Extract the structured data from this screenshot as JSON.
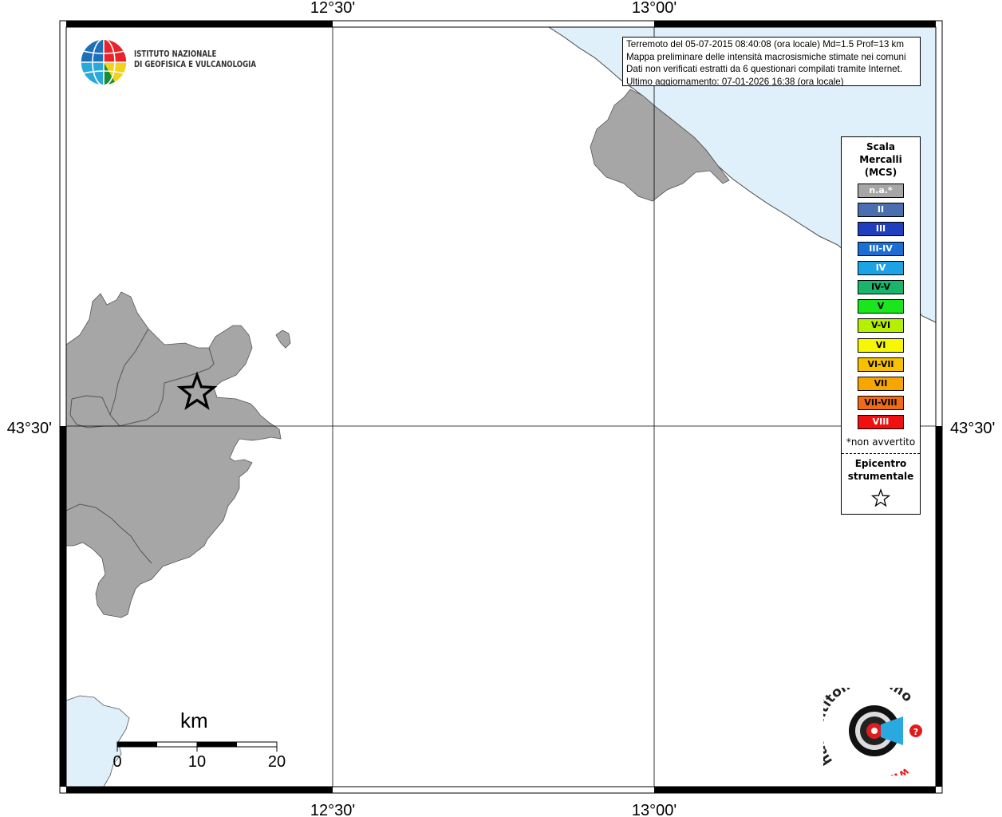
{
  "map": {
    "axes": {
      "top_labels": [
        "12°30'",
        "13°00'"
      ],
      "bottom_labels": [
        "12°30'",
        "13°00'"
      ],
      "left_label": "43°30'",
      "right_label": "43°30'"
    },
    "colors": {
      "land": "#a6a6a6",
      "sea": "#dff0fb",
      "frame": "#000000"
    }
  },
  "institute_logo": {
    "line1": "ISTITUTO NAZIONALE",
    "line2": "DI GEOFISICA E VULCANOLOGIA",
    "icon": "globe-icon"
  },
  "info_box": {
    "lines": [
      "Terremoto del 05-07-2015 08:40:08 (ora locale) Md=1.5 Prof=13 km",
      "Mappa preliminare delle intensità macrosismiche stimate nei comuni",
      "Dati non verificati estratti da 6 questionari compilati tramite Internet.",
      "Ultimo aggiornamento: 07-01-2026 16:38 (ora locale)"
    ]
  },
  "legend": {
    "title_lines": [
      "Scala",
      "Mercalli",
      "(MCS)"
    ],
    "items": [
      {
        "label": "n.a.*",
        "color": "#a6a6a6",
        "text_color": "#ffffff"
      },
      {
        "label": "II",
        "color": "#4a6fb0",
        "text_color": "#ffffff"
      },
      {
        "label": "III",
        "color": "#1f3fbf",
        "text_color": "#ffffff"
      },
      {
        "label": "III-IV",
        "color": "#1a6fd4",
        "text_color": "#ffffff"
      },
      {
        "label": "IV",
        "color": "#1ca3e6",
        "text_color": "#ffffff"
      },
      {
        "label": "IV-V",
        "color": "#19b56a",
        "text_color": "#000000"
      },
      {
        "label": "V",
        "color": "#19e61c",
        "text_color": "#000000"
      },
      {
        "label": "V-VI",
        "color": "#b5f000",
        "text_color": "#000000"
      },
      {
        "label": "VI",
        "color": "#f7f700",
        "text_color": "#000000"
      },
      {
        "label": "VI-VII",
        "color": "#f7c000",
        "text_color": "#000000"
      },
      {
        "label": "VII",
        "color": "#f7a600",
        "text_color": "#000000"
      },
      {
        "label": "VII-VIII",
        "color": "#f06b16",
        "text_color": "#000000"
      },
      {
        "label": "VIII",
        "color": "#f01010",
        "text_color": "#ffffff"
      }
    ],
    "note": "*non avvertito",
    "epicenter_lines": [
      "Epicentro",
      "strumentale"
    ],
    "epicenter_icon": "star-icon"
  },
  "scale_bar": {
    "unit": "km",
    "tick_labels": [
      "0",
      "10",
      "20"
    ]
  },
  "haisentito_logo": {
    "text": "haisentitoilterremoto.it",
    "url_text": "www.",
    "icon": "radar-icon"
  }
}
